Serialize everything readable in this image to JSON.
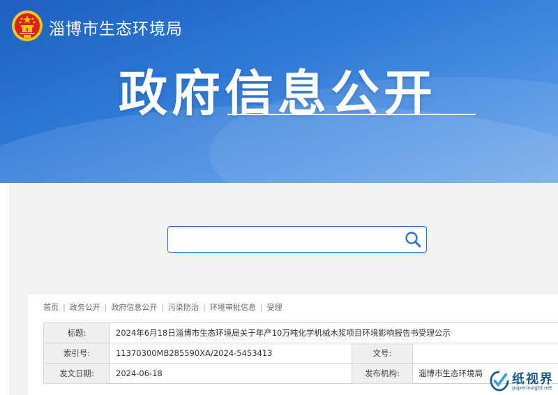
{
  "header": {
    "org_name": "淄博市生态环境局",
    "big_title": "政府信息公开"
  },
  "search": {
    "value": "",
    "placeholder": ""
  },
  "breadcrumb": [
    "首页",
    "政务公开",
    "政府信息公开",
    "污染防治",
    "环境审批信息",
    "受理"
  ],
  "info_table": {
    "title_label": "标题:",
    "title_value": "2024年6月18日淄博市生态环境局关于年产10万吨化学机械木浆项目环境影响报告书受理公示",
    "index_label": "索引号:",
    "index_value": "11370300MB285590XA/2024-5453413",
    "docno_label": "文号:",
    "docno_value": "",
    "date_label": "发文日期:",
    "date_value": "2024-06-18",
    "issuer_label": "发布机构:",
    "issuer_value": "淄博市生态环境局"
  },
  "watermark": {
    "text": "纸视界",
    "sub": "paperinsight.net"
  },
  "colors": {
    "banner": "#2f79d6",
    "accent": "#2a6fc9",
    "emblem_red": "#d7261e",
    "emblem_gold": "#f5c518"
  },
  "icons": {
    "emblem": "national-emblem-icon",
    "search": "search-icon",
    "watermark_logo": "paperinsight-logo-icon"
  }
}
